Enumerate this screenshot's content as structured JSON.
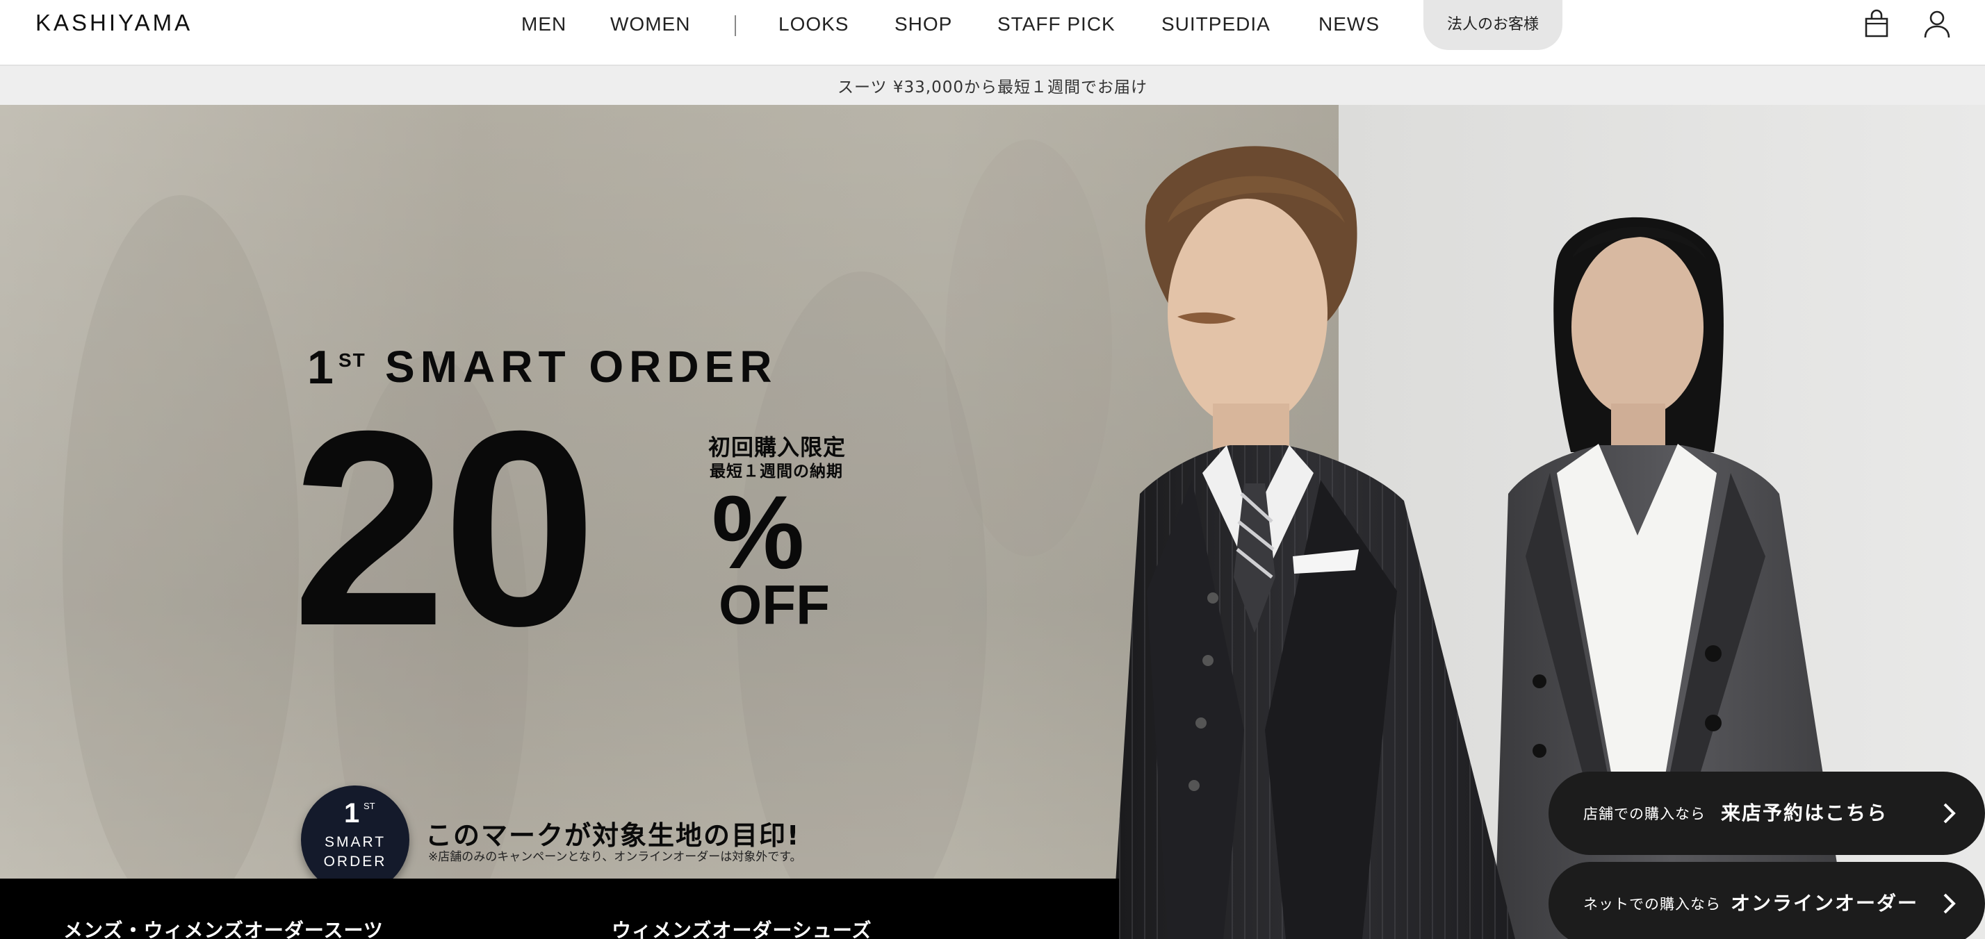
{
  "header": {
    "logo": "KASHIYAMA",
    "nav": [
      "MEN",
      "WOMEN",
      "LOOKS",
      "SHOP",
      "STAFF PICK",
      "SUITPEDIA",
      "NEWS"
    ],
    "corporate_button": "法人のお客様",
    "icons": [
      "cart-icon",
      "user-icon"
    ]
  },
  "announcement": "スーツ ¥33,000から最短１週間でお届け",
  "hero": {
    "promo": {
      "ordinal_number": "1",
      "ordinal_suffix": "ST",
      "title": "SMART ORDER",
      "discount_number": "20",
      "discount_symbol": "%",
      "discount_word": "OFF",
      "jp_line1": "初回購入限定",
      "jp_line2": "最短１週間の納期"
    },
    "badge": {
      "number": "1",
      "suffix": "ST",
      "line2": "SMART",
      "line3": "ORDER"
    },
    "mark_text": "このマークが対象生地の目印!",
    "mark_note": "※店舗のみのキャンペーンとなり、オンラインオーダーは対象外です。",
    "categories": [
      "メンズ・ウィメンズオーダースーツ",
      "ウィメンズオーダーシューズ"
    ],
    "cta": [
      {
        "small": "店舗での購入なら",
        "large": "来店予約はこちら"
      },
      {
        "small": "ネットでの購入なら",
        "large": "オンラインオーダー"
      }
    ]
  },
  "colors": {
    "header_bg": "#ffffff",
    "announce_bg": "#eeeeee",
    "corp_button_bg": "#e6e6e6",
    "cta_bg": "#1c1c1c",
    "badge_bg": "#141a2b",
    "hero_bottom_band": "#000000"
  }
}
